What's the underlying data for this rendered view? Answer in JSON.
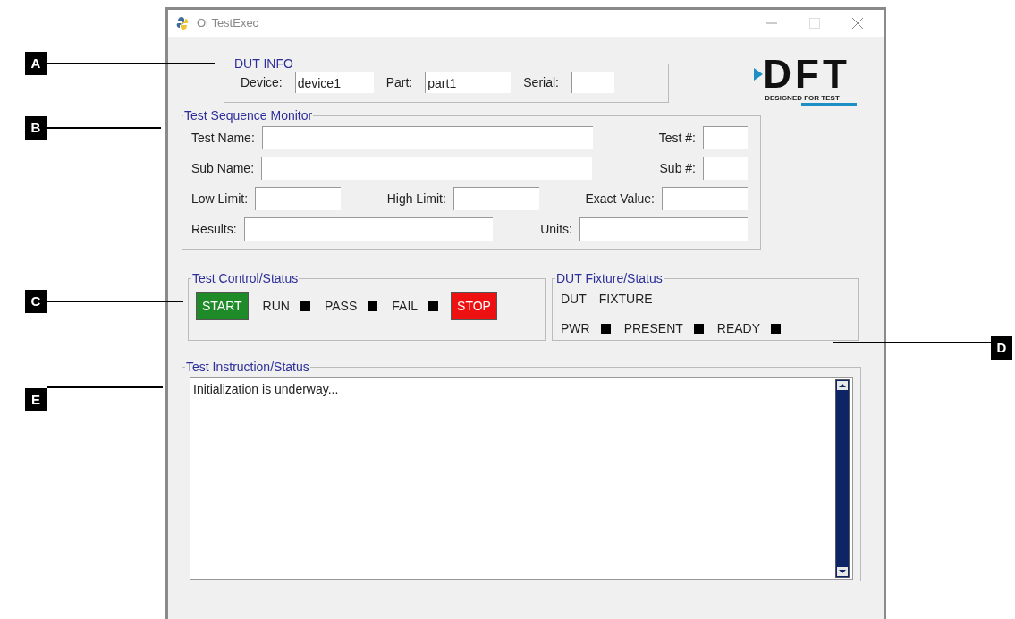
{
  "window": {
    "title": "Oi TestExec"
  },
  "callouts": [
    {
      "label": "A"
    },
    {
      "label": "B"
    },
    {
      "label": "C"
    },
    {
      "label": "D"
    },
    {
      "label": "E"
    }
  ],
  "dut_info": {
    "title": "DUT INFO",
    "fields": [
      {
        "label": "Device:",
        "value": "device1"
      },
      {
        "label": "Part:",
        "value": "part1"
      },
      {
        "label": "Serial:"
      }
    ]
  },
  "logo": {
    "letters": "DFT",
    "tagline": "DESIGNED FOR TEST"
  },
  "test_sequence_monitor": {
    "title": "Test Sequence Monitor",
    "rows": [
      [
        {
          "label": "Test Name:"
        },
        {
          "label": "Test #:"
        }
      ],
      [
        {
          "label": "Sub Name:"
        },
        {
          "label": "Sub #:"
        }
      ],
      [
        {
          "label": "Low Limit:"
        },
        {
          "label": "High Limit:"
        },
        {
          "label": "Exact Value:"
        }
      ],
      [
        {
          "label": "Results:"
        },
        {
          "label": "Units:"
        }
      ]
    ]
  },
  "test_control": {
    "title": "Test Control/Status",
    "items": [
      {
        "kind": "button",
        "label": "START",
        "color": "#1e8a28"
      },
      {
        "kind": "indicator",
        "label": "RUN"
      },
      {
        "kind": "indicator",
        "label": "PASS"
      },
      {
        "kind": "indicator",
        "label": "FAIL"
      },
      {
        "kind": "button",
        "label": "STOP",
        "color": "#ee1111"
      }
    ]
  },
  "dut_fixture": {
    "title": "DUT Fixture/Status",
    "headings": [
      "DUT",
      "FIXTURE"
    ],
    "indicators": [
      {
        "label": "PWR"
      },
      {
        "label": "PRESENT"
      },
      {
        "label": "READY"
      }
    ]
  },
  "test_instruction": {
    "title": "Test Instruction/Status",
    "text": "Initialization is underway..."
  }
}
